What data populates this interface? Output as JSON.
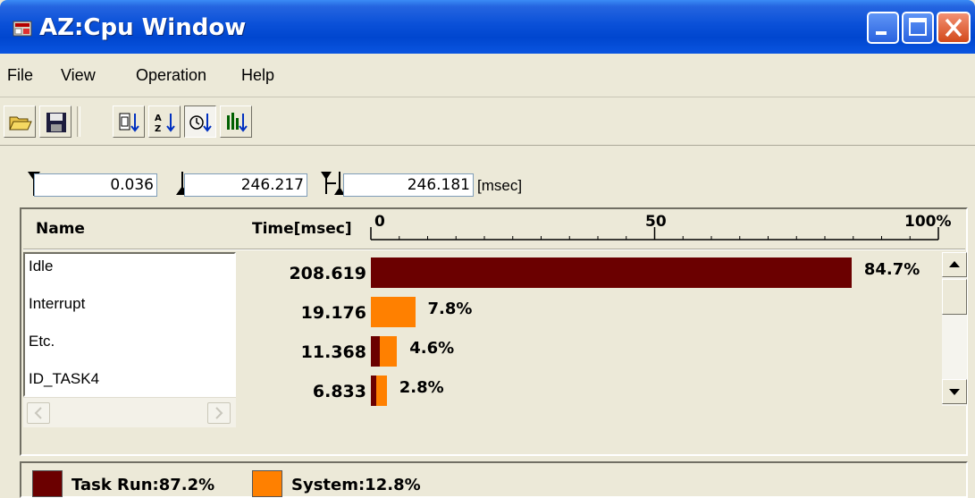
{
  "window": {
    "title": "AZ:Cpu Window",
    "title_icon": "cpu-app-icon"
  },
  "window_controls": {
    "minimize_icon": "minimize-icon",
    "maximize_icon": "maximize-icon",
    "close_icon": "close-icon"
  },
  "menu": [
    {
      "label": "File"
    },
    {
      "label": "View"
    },
    {
      "label": "Operation"
    },
    {
      "label": "Help"
    }
  ],
  "toolbar": {
    "buttons": [
      {
        "icon": "open-folder-icon"
      },
      {
        "icon": "save-disk-icon"
      },
      {
        "icon": "sort-by-number-icon"
      },
      {
        "icon": "sort-alphabetical-icon"
      },
      {
        "icon": "sort-by-time-icon",
        "pressed": true
      },
      {
        "icon": "sort-by-bar-icon"
      }
    ]
  },
  "range": {
    "start": "0.036",
    "end": "246.217",
    "span": "246.181",
    "unit": "[msec]",
    "start_icon": "start-marker-icon",
    "end_icon": "end-marker-icon",
    "span_icon": "span-marker-icon"
  },
  "table": {
    "name_header": "Name",
    "time_header": "Time[msec]",
    "axis": {
      "ticks": [
        "0",
        "50",
        "100%"
      ]
    },
    "rows": [
      {
        "name": "Idle",
        "time": "208.619",
        "percent_label": "84.7%",
        "percent": 84.7,
        "task_run": 84.7,
        "system": 0
      },
      {
        "name": "Interrupt",
        "time": "19.176",
        "percent_label": "7.8%",
        "percent": 7.8,
        "task_run": 0,
        "system": 7.8
      },
      {
        "name": "Etc.",
        "time": "11.368",
        "percent_label": "4.6%",
        "percent": 4.6,
        "task_run": 1.6,
        "system": 3.0
      },
      {
        "name": "ID_TASK4",
        "time": "6.833",
        "percent_label": "2.8%",
        "percent": 2.8,
        "task_run": 0.9,
        "system": 1.9
      }
    ]
  },
  "legend": [
    {
      "label": "Task Run:87.2%",
      "color": "#6b0000"
    },
    {
      "label": "System:12.8%",
      "color": "#ff8000"
    }
  ],
  "colors": {
    "task_run": "#6b0000",
    "system": "#ff8000",
    "titlebar": "#0a50d8"
  }
}
